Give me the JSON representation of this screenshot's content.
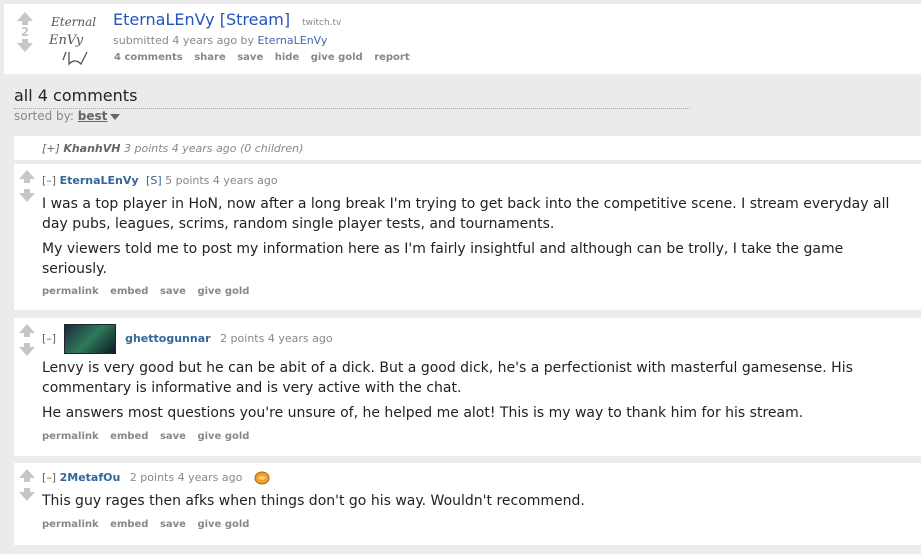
{
  "post": {
    "score": "2",
    "thumbnail_text": [
      "Eternal",
      "EnVy"
    ],
    "title": "EternaLEnVy [Stream]",
    "domain": "twitch.tv",
    "tagline_prefix": "submitted 4 years ago by",
    "author": "EternaLEnVy",
    "buttons": [
      "4 comments",
      "share",
      "save",
      "hide",
      "give gold",
      "report"
    ]
  },
  "comments_header": "all 4 comments",
  "sort": {
    "label": "sorted by:",
    "value": "best"
  },
  "comments": [
    {
      "expand": "[+]",
      "author": "KhanhVH",
      "meta": "3 points 4 years ago (0 children)"
    },
    {
      "expand": "[–]",
      "author": "EternaLEnVy",
      "submitter_tag": "[S]",
      "meta": "5 points 4 years ago",
      "paragraphs": [
        "I was a top player in HoN, now after a long break I'm trying to get back into the competitive scene. I stream everyday all day pubs, leagues, scrims, random single player tests, and tournaments.",
        "My viewers told me to post my information here as I'm fairly insightful and although can be trolly, I take the game seriously."
      ],
      "buttons": [
        "permalink",
        "embed",
        "save",
        "give gold"
      ]
    },
    {
      "expand": "[–]",
      "author": "ghettogunnar",
      "meta": "2 points 4 years ago",
      "paragraphs": [
        "Lenvy is very good but he can be abit of a dick. But a good dick, he's a perfectionist with masterful gamesense. His commentary is informative and is very active with the chat.",
        "He answers most questions you're unsure of, he helped me alot! This is my way to thank him for his stream."
      ],
      "buttons": [
        "permalink",
        "embed",
        "save",
        "give gold"
      ]
    },
    {
      "expand": "[–]",
      "author": "2MetafOu",
      "meta": "2 points 4 years ago",
      "paragraphs": [
        "This guy rages then afks when things don't go his way. Wouldn't recommend."
      ],
      "buttons": [
        "permalink",
        "embed",
        "save",
        "give gold"
      ]
    }
  ]
}
